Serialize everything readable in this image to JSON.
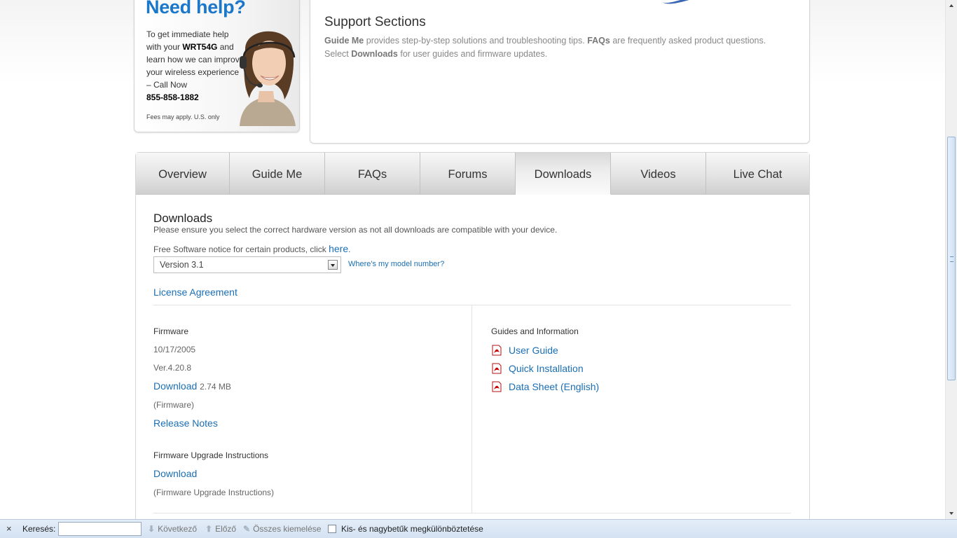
{
  "help": {
    "title": "Need help?",
    "text_before": "To get immediate help with your ",
    "model": "WRT54G",
    "text_after": " and learn how we can improve your wireless experience – Call Now",
    "phone": "855-858-1882",
    "fees": "Fees may apply. U.S. only"
  },
  "support": {
    "title": "Support Sections",
    "guide_me": "Guide Me",
    "text1": " provides step-by-step solutions and troubleshooting tips. ",
    "faqs": "FAQs",
    "text2": " are frequently asked product questions.",
    "text3": "Select ",
    "downloads": "Downloads",
    "text4": " for user guides and firmware updates."
  },
  "tabs": [
    {
      "label": "Overview",
      "active": false
    },
    {
      "label": "Guide Me",
      "active": false
    },
    {
      "label": "FAQs",
      "active": false
    },
    {
      "label": "Forums",
      "active": false
    },
    {
      "label": "Downloads",
      "active": true
    },
    {
      "label": "Videos",
      "active": false
    },
    {
      "label": "Live Chat",
      "active": false
    }
  ],
  "downloads": {
    "title": "Downloads",
    "note": "Please ensure you select the correct hardware version as not all downloads are compatible with your device.",
    "free_notice": "Free Software notice for certain products, click ",
    "here_link": "here",
    "period": ".",
    "version_selected": "Version 3.1",
    "model_link": "Where's my model number?",
    "license": "License Agreement"
  },
  "firmware": {
    "heading": "Firmware",
    "date": "10/17/2005",
    "version": "Ver.4.20.8",
    "download_label": "Download",
    "size": "2.74 MB",
    "type": "(Firmware)",
    "release_notes": "Release Notes",
    "upgrade_heading": "Firmware Upgrade Instructions",
    "upgrade_download": "Download",
    "upgrade_type": "(Firmware Upgrade Instructions)"
  },
  "guides": {
    "heading": "Guides and Information",
    "items": [
      "User Guide",
      "Quick Installation",
      "Data Sheet (English)"
    ]
  },
  "findbar": {
    "close": "×",
    "label": "Keresés:",
    "input_value": "",
    "next": "Következő",
    "prev": "Előző",
    "highlight_all": "Összes kiemelése",
    "match_case": "Kis- és nagybetűk megkülönböztetése"
  },
  "colors": {
    "link": "#1a6fb5",
    "brand_title": "#1a77c9"
  }
}
